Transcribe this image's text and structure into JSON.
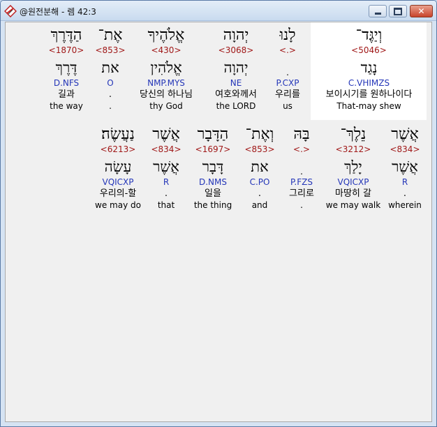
{
  "window": {
    "title": "@원전분해 - 렘 42:3",
    "controls": {
      "minimize": "minimize-icon",
      "maximize": "maximize-icon",
      "close": "✕"
    }
  },
  "rows": [
    {
      "words": [
        {
          "hebrew": "וְיַגֶּד־",
          "strong": "<5046>",
          "lemma": "נָגַד",
          "morph": "C.VHIMZS",
          "korean": "보이시기를 원하나이다",
          "english": "That-may shew",
          "highlight": true
        },
        {
          "hebrew": "לָנוּ",
          "strong": "<.>",
          "lemma": "ׅ",
          "morph": "P.CXP",
          "korean": "우리를",
          "english": "us"
        },
        {
          "hebrew": "יְהוָה",
          "strong": "<3068>",
          "lemma": "יְהוָה",
          "morph": "NE",
          "korean": "여호와께서",
          "english": "the LORD"
        },
        {
          "hebrew": "אֱלֹהֶיךָ",
          "strong": "<430>",
          "lemma": "אֱלֹהִין",
          "morph": "NMP.MYS",
          "korean": "당신의 하나님",
          "english": "thy God"
        },
        {
          "hebrew": "אֶת־",
          "strong": "<853>",
          "lemma": "את",
          "morph": "O",
          "korean": ".",
          "english": "."
        },
        {
          "hebrew": "הַדֶּרֶךְ",
          "strong": "<1870>",
          "lemma": "דֶּרֶךְ",
          "morph": "D.NFS",
          "korean": "길과",
          "english": "the way"
        }
      ]
    },
    {
      "words": [
        {
          "hebrew": "אֲשֶׁר",
          "strong": "<834>",
          "lemma": "אֲשֶׁר",
          "morph": "R",
          "korean": ".",
          "english": "wherein"
        },
        {
          "hebrew": "נֵלֶךְ־",
          "strong": "<3212>",
          "lemma": "יָלַךְ",
          "morph": "VQICXP",
          "korean": "마땅히 갈",
          "english": "we may walk"
        },
        {
          "hebrew": "בָּהּ",
          "strong": "<.>",
          "lemma": "ׅ",
          "morph": "P.FZS",
          "korean": "그리로",
          "english": "."
        },
        {
          "hebrew": "וְאֶת־",
          "strong": "<853>",
          "lemma": "את",
          "morph": "C.PO",
          "korean": ".",
          "english": "and"
        },
        {
          "hebrew": "הַדָּבָר",
          "strong": "<1697>",
          "lemma": "דָּבָר",
          "morph": "D.NMS",
          "korean": "일을",
          "english": "the thing"
        },
        {
          "hebrew": "אֲשֶׁר",
          "strong": "<834>",
          "lemma": "אֲשֶׁר",
          "morph": "R",
          "korean": ".",
          "english": "that"
        },
        {
          "hebrew": "נַעֲשֶׂה׃",
          "strong": "<6213>",
          "lemma": "עָשָׂה",
          "morph": "VQICXP",
          "korean": "우리의-할",
          "english": "we may do"
        }
      ]
    }
  ]
}
